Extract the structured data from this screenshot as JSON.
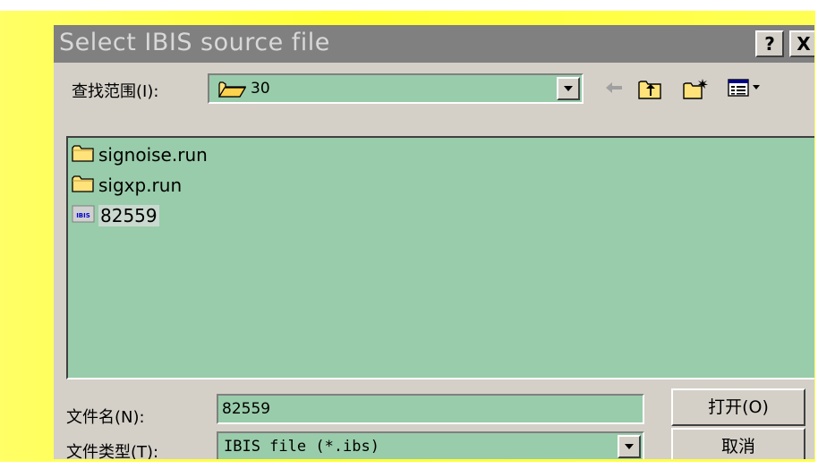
{
  "dialog": {
    "title": "Select IBIS source file",
    "help_label": "?",
    "close_label": "X"
  },
  "lookin": {
    "label": "查找范围(I):",
    "value": "30"
  },
  "toolbar": {
    "back_icon": "back-arrow-icon",
    "up_icon": "up-one-level-icon",
    "new_folder_icon": "new-folder-icon",
    "view_menu_icon": "view-menu-icon"
  },
  "files": [
    {
      "name": "signoise.run",
      "icon": "folder-icon",
      "selected": false
    },
    {
      "name": "sigxp.run",
      "icon": "folder-icon",
      "selected": false
    },
    {
      "name": "82559",
      "icon": "ibis-file-icon",
      "icon_text": "IBIS",
      "selected": true
    }
  ],
  "filename": {
    "label": "文件名(N):",
    "value": "82559"
  },
  "filetype": {
    "label": "文件类型(T):",
    "value": "IBIS file (*.ibs)"
  },
  "buttons": {
    "open": "打开(O)",
    "cancel": "取消"
  },
  "colors": {
    "list_bg": "#99ccaa",
    "frame": "#ffff33",
    "titlebar": "#808080"
  }
}
